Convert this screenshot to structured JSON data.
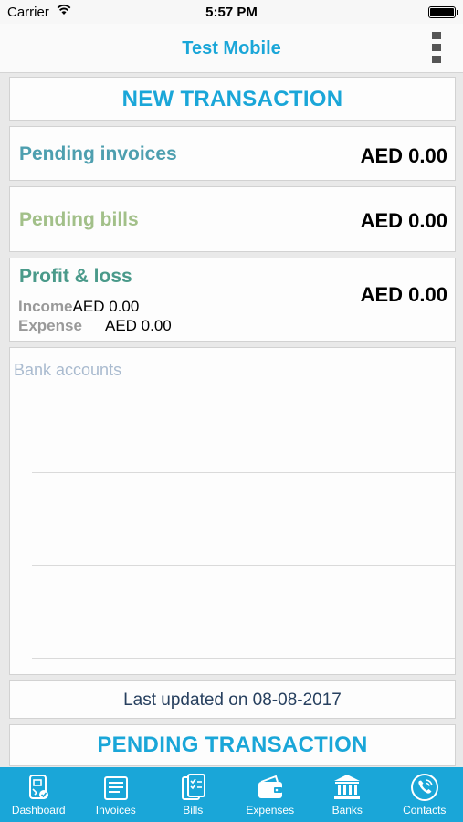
{
  "status_bar": {
    "carrier": "Carrier",
    "time": "5:57 PM"
  },
  "header": {
    "title": "Test Mobile",
    "menu_icon": "more-vertical-icon"
  },
  "new_transaction": {
    "label": "NEW TRANSACTION"
  },
  "pending_invoices": {
    "label": "Pending invoices",
    "amount": "AED 0.00",
    "color": "#4e9faf"
  },
  "pending_bills": {
    "label": "Pending bills",
    "amount": "AED 0.00",
    "color": "#a2c089"
  },
  "profit_loss": {
    "label": "Profit & loss",
    "amount": "AED 0.00",
    "color": "#4a9a8a",
    "income_label": "Income",
    "income_value": "AED 0.00",
    "expense_label": "Expense",
    "expense_value": "AED 0.00"
  },
  "bank_accounts": {
    "title": "Bank accounts"
  },
  "last_updated": {
    "text": "Last updated on 08-08-2017"
  },
  "pending_transaction": {
    "label": "PENDING TRANSACTION"
  },
  "tabs": [
    {
      "label": "Dashboard",
      "icon": "dashboard-icon"
    },
    {
      "label": "Invoices",
      "icon": "invoices-icon"
    },
    {
      "label": "Bills",
      "icon": "bills-icon"
    },
    {
      "label": "Expenses",
      "icon": "wallet-icon"
    },
    {
      "label": "Banks",
      "icon": "bank-icon"
    },
    {
      "label": "Contacts",
      "icon": "phone-icon"
    }
  ],
  "colors": {
    "accent": "#1aa6d8",
    "background": "#e9e9e9"
  }
}
